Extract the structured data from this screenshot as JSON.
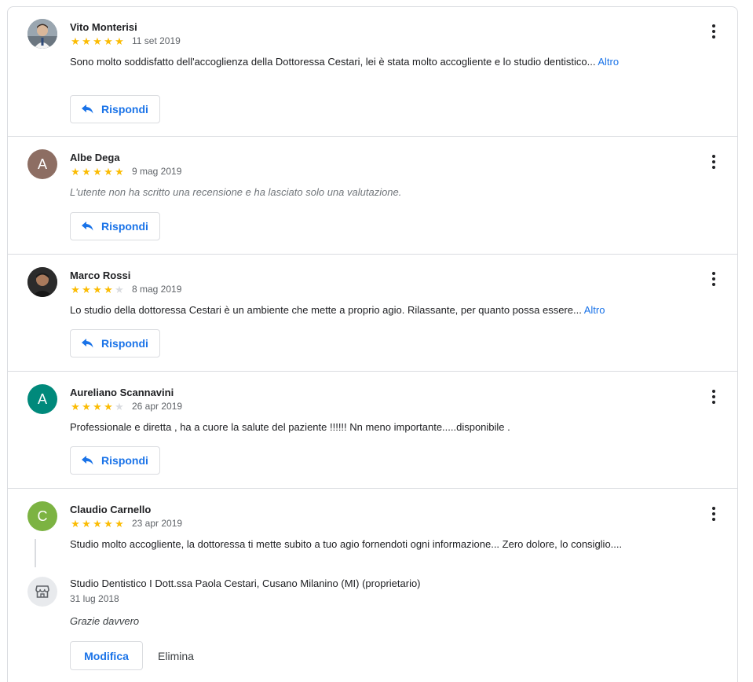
{
  "reviews": [
    {
      "name": "Vito Monterisi",
      "avatar_type": "photo",
      "rating": 5,
      "date": "11 set 2019",
      "text": "Sono molto soddisfatto dell'accoglienza della Dottoressa Cestari, lei è stata molto accogliente e lo studio dentistico...",
      "more": "Altro",
      "reply": "Rispondi"
    },
    {
      "name": "Albe Dega",
      "avatar_letter": "A",
      "avatar_color": "#8d6e63",
      "rating": 5,
      "date": "9 mag 2019",
      "text": "L'utente non ha scritto una recensione e ha lasciato solo una valutazione.",
      "reply": "Rispondi"
    },
    {
      "name": "Marco Rossi",
      "avatar_type": "photo",
      "rating": 4,
      "date": "8 mag 2019",
      "text": "Lo studio della dottoressa Cestari è un ambiente che mette a proprio agio. Rilassante, per quanto possa essere...",
      "more": "Altro",
      "reply": "Rispondi"
    },
    {
      "name": "Aureliano Scannavini",
      "avatar_letter": "A",
      "avatar_color": "#00897b",
      "rating": 4,
      "date": "26 apr 2019",
      "text": "Professionale e diretta , ha a cuore la salute del paziente !!!!!! Nn meno importante.....disponibile .",
      "reply": "Rispondi"
    },
    {
      "name": "Claudio Carnello",
      "avatar_letter": "C",
      "avatar_color": "#7cb342",
      "rating": 5,
      "date": "23 apr 2019",
      "text": "Studio molto accogliente, la dottoressa ti mette subito a tuo agio fornendoti ogni informazione... Zero dolore, lo consiglio...."
    }
  ],
  "owner_reply": {
    "name": "Studio Dentistico I Dott.ssa Paola Cestari, Cusano Milanino (MI) (proprietario)",
    "date": "31 lug 2018",
    "text": "Grazie davvero",
    "edit_label": "Modifica",
    "delete_label": "Elimina",
    "icon": "storefront-icon"
  },
  "colors": {
    "star": "#fbbc04",
    "star_empty": "#dadce0",
    "link": "#1a73e8",
    "divider": "#dadce0"
  }
}
